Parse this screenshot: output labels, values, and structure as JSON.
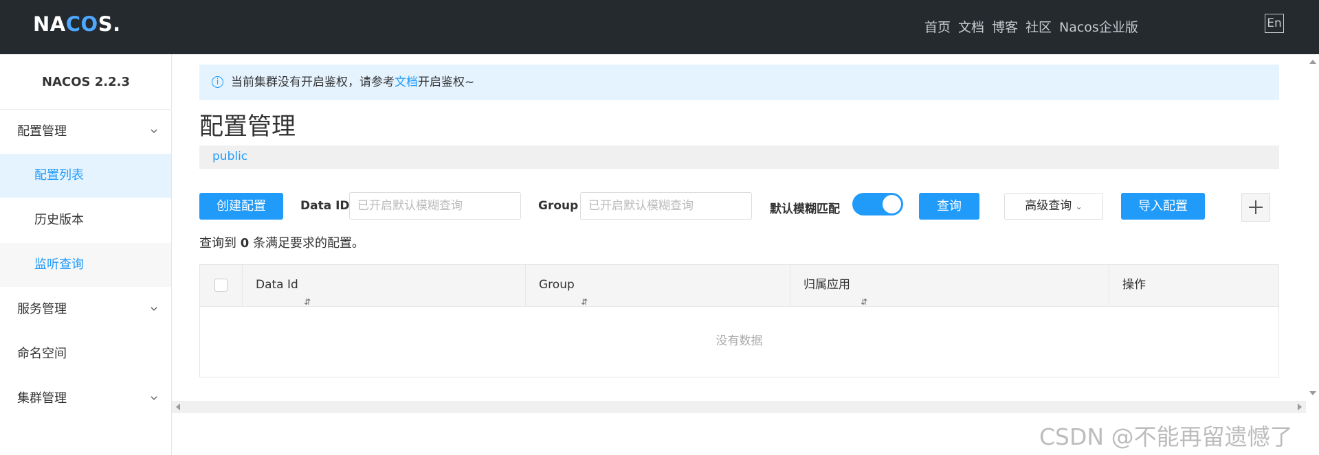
{
  "header": {
    "logo": "NACOS.",
    "nav": [
      "首页",
      "文档",
      "博客",
      "社区",
      "Nacos企业版"
    ],
    "lang": "En"
  },
  "sidebar": {
    "version": "NACOS 2.2.3",
    "items": [
      {
        "label": "配置管理",
        "expandable": true
      },
      {
        "label": "配置列表",
        "sub": true,
        "active": true
      },
      {
        "label": "历史版本",
        "sub": true
      },
      {
        "label": "监听查询",
        "sub": true
      },
      {
        "label": "服务管理",
        "expandable": true
      },
      {
        "label": "命名空间"
      },
      {
        "label": "集群管理",
        "expandable": true
      }
    ]
  },
  "notice": {
    "prefix": "当前集群没有开启鉴权，请参考",
    "link": "文档",
    "suffix": "开启鉴权~"
  },
  "page": {
    "title": "配置管理",
    "namespace": "public"
  },
  "toolbar": {
    "create_label": "创建配置",
    "dataid_label": "Data ID",
    "dataid_placeholder": "已开启默认模糊查询",
    "group_label": "Group",
    "group_placeholder": "已开启默认模糊查询",
    "fuzzy_label": "默认模糊匹配",
    "fuzzy_on": true,
    "query_label": "查询",
    "advanced_label": "高级查询",
    "import_label": "导入配置"
  },
  "result": {
    "prefix": "查询到",
    "count": "0",
    "suffix": "条满足要求的配置。"
  },
  "table": {
    "columns": [
      "Data Id",
      "Group",
      "归属应用",
      "操作"
    ],
    "empty_text": "没有数据"
  },
  "watermark": "CSDN @不能再留遗憾了",
  "colors": {
    "topbar": "#252a2f",
    "accent": "#209bfa",
    "notice_bg": "#e5f3ff"
  }
}
